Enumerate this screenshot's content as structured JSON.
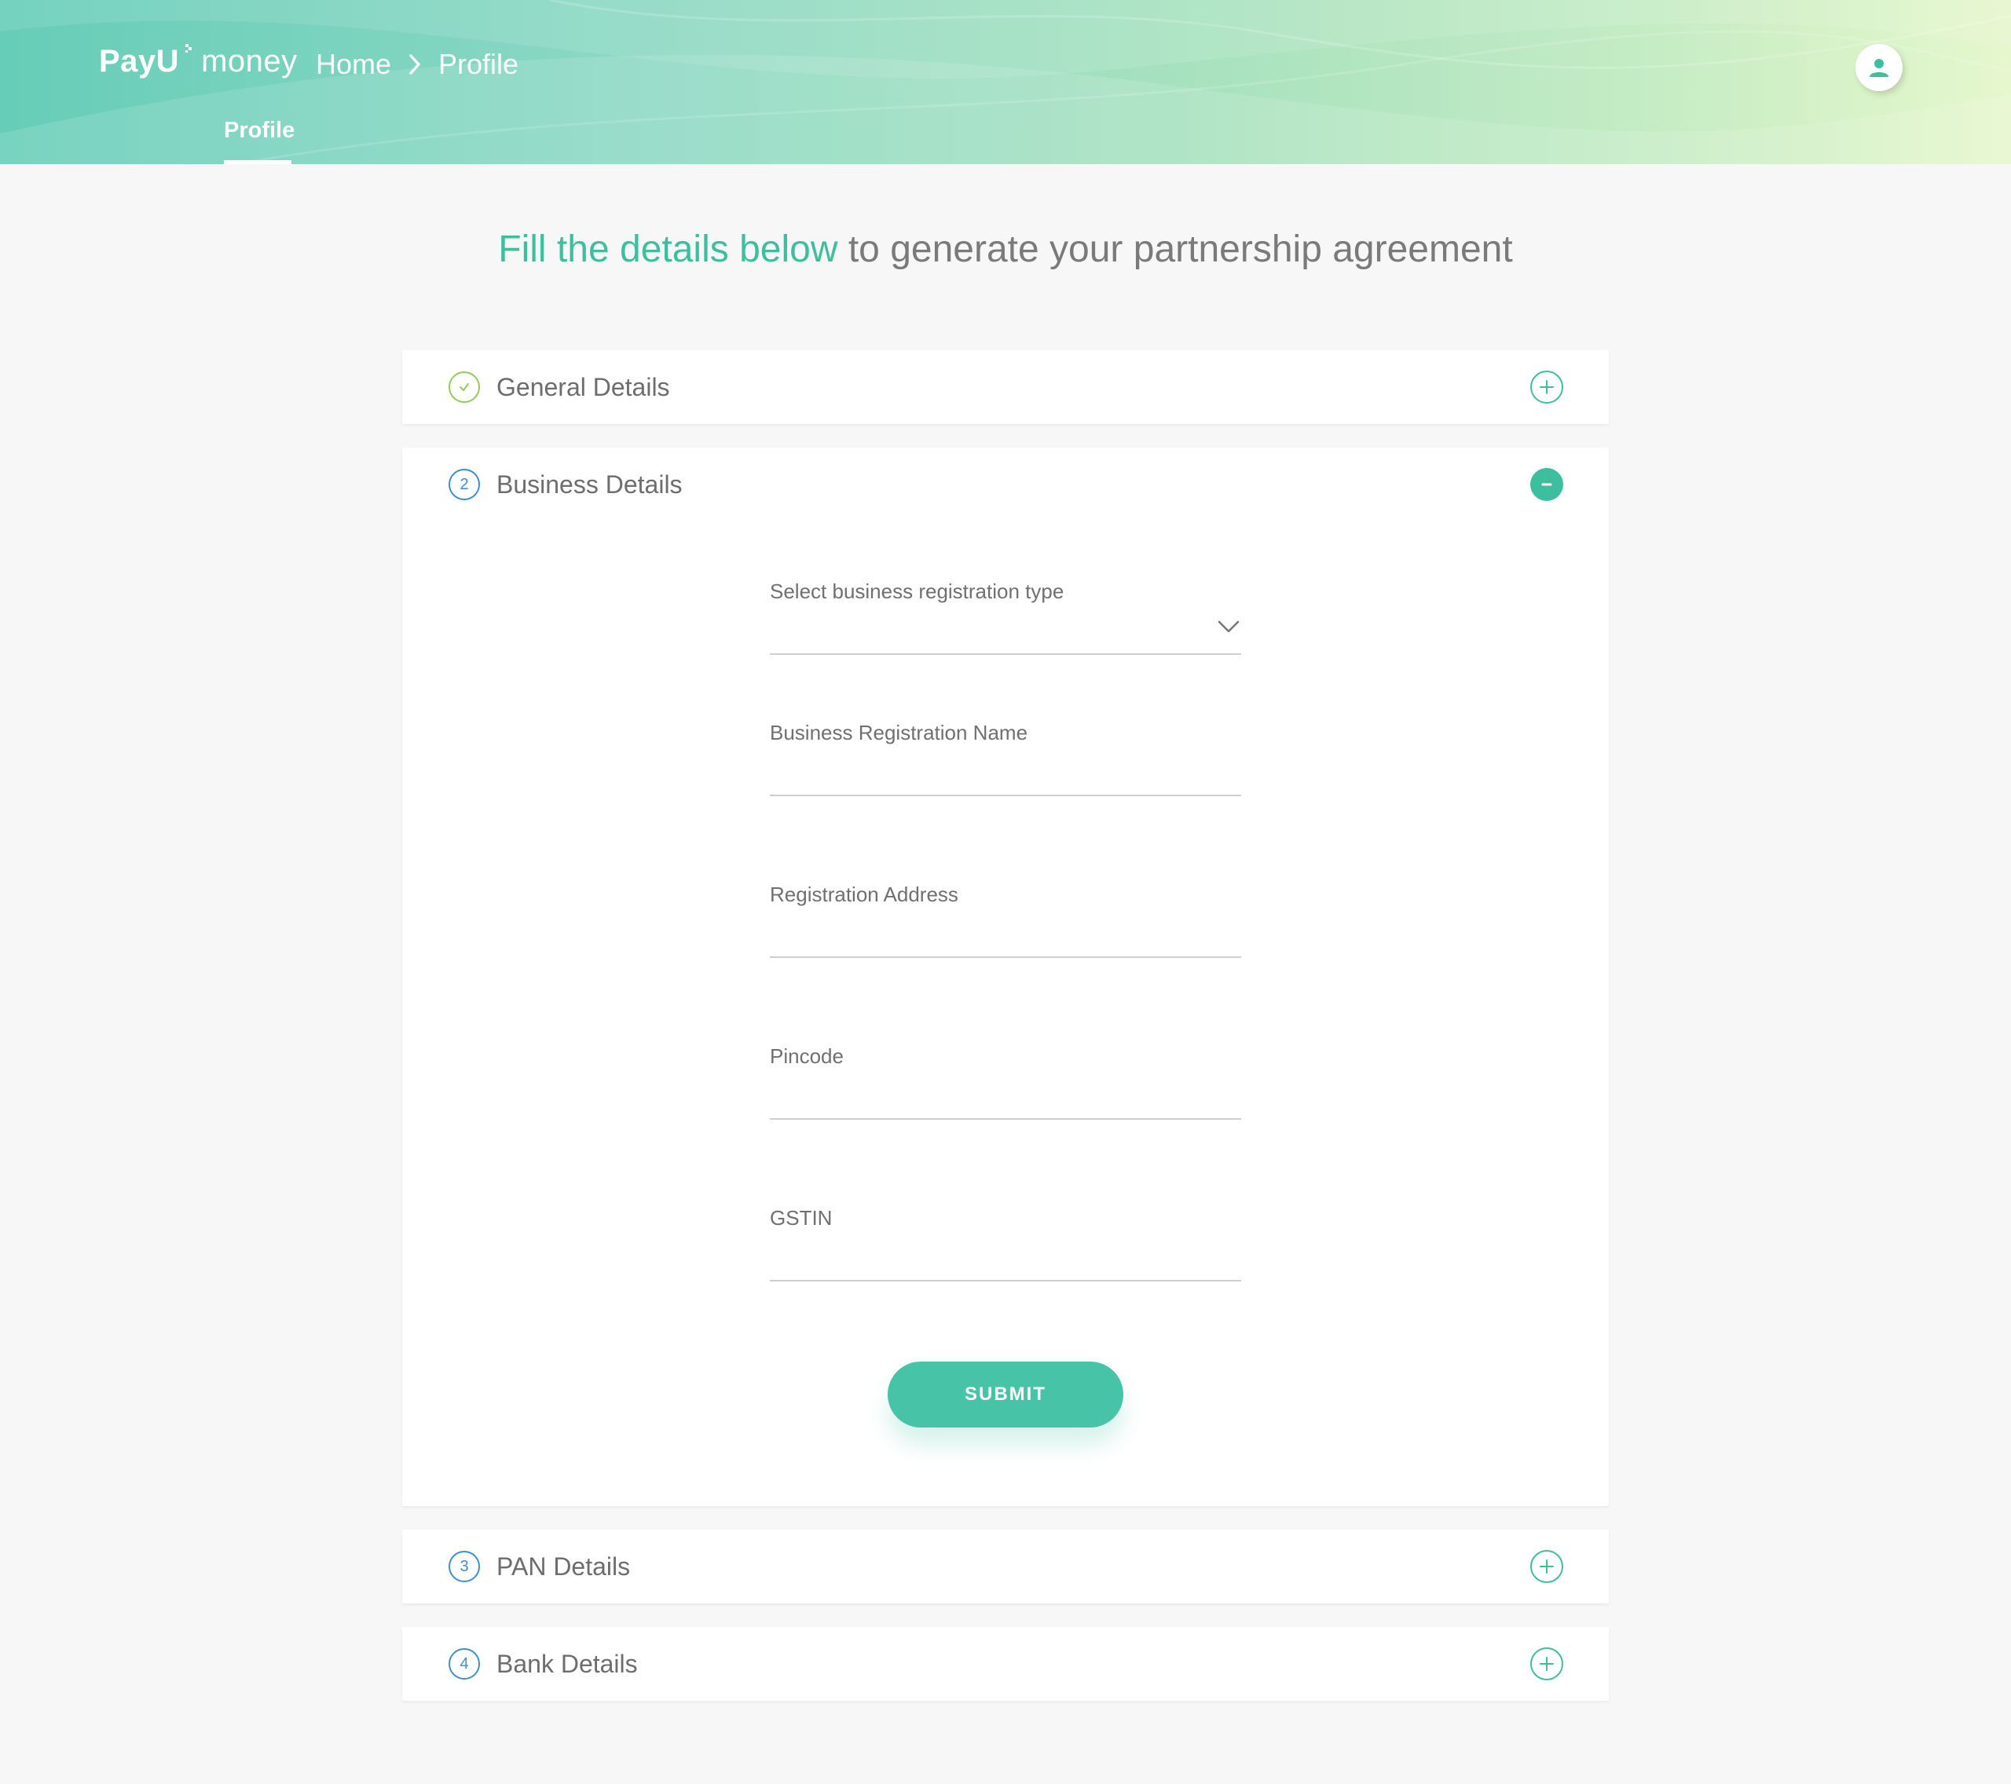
{
  "app": {
    "logo_payu": "PayU",
    "logo_money": "money"
  },
  "breadcrumb": {
    "home": "Home",
    "current": "Profile"
  },
  "subnav": {
    "active_tab": "Profile"
  },
  "heading": {
    "accent": "Fill the details below",
    "rest": " to generate your partnership agreement"
  },
  "sections": [
    {
      "step": "",
      "title": "General Details",
      "status": "completed",
      "expanded": false
    },
    {
      "step": "2",
      "title": "Business Details",
      "status": "active",
      "expanded": true
    },
    {
      "step": "3",
      "title": "PAN Details",
      "status": "pending",
      "expanded": false
    },
    {
      "step": "4",
      "title": "Bank Details",
      "status": "pending",
      "expanded": false
    }
  ],
  "business_form": {
    "registration_type_label": "Select business registration type",
    "registration_type_value": "",
    "registration_name_label": "Business Registration Name",
    "registration_name_value": "",
    "address_label": "Registration Address",
    "address_value": "",
    "pincode_label": "Pincode",
    "pincode_value": "",
    "gstin_label": "GSTIN",
    "gstin_value": "",
    "submit_label": "SUBMIT"
  },
  "colors": {
    "accent": "#3dbf9f",
    "button": "#47c4a7",
    "step_blue": "#3a8fd6",
    "done_green": "#8fce5a"
  },
  "icons": {
    "breadcrumb_separator": "chevron-right-icon",
    "avatar": "user-icon",
    "collapsed_toggle": "plus-circle-icon",
    "expanded_toggle": "minus-circle-icon",
    "completed_step": "check-circle-icon",
    "select": "chevron-down-icon"
  }
}
